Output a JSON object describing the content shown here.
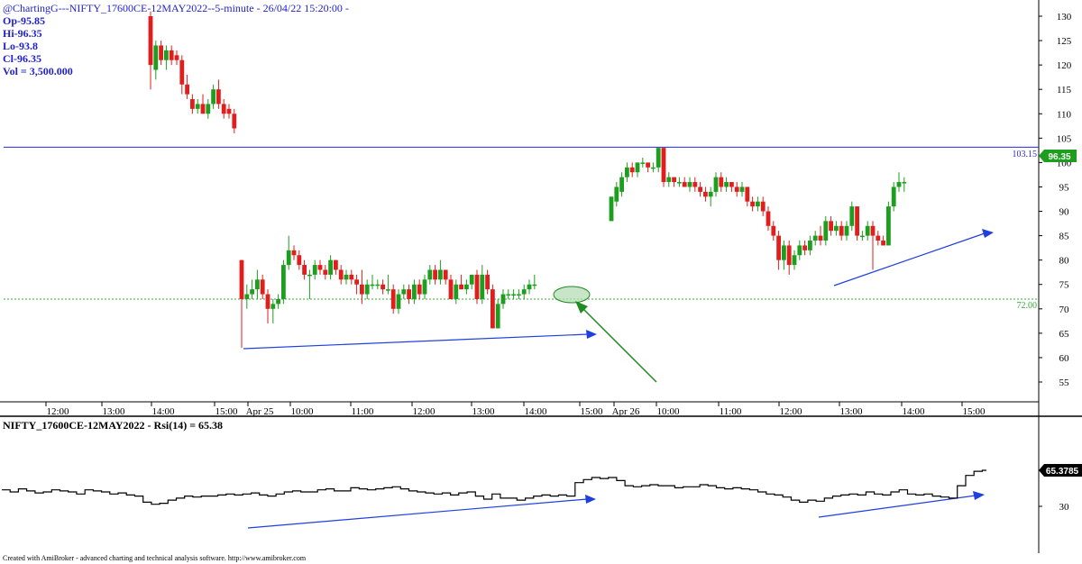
{
  "header": {
    "title": "@ChartingG---NIFTY_17600CE-12MAY2022--5-minute  - 26/04/22 15:20:00 -",
    "open": "Op-95.85",
    "high": "Hi-96.35",
    "low": "Lo-93.8",
    "close": "Cl-96.35",
    "volume": "Vol = 3,500.000"
  },
  "rsi_panel": {
    "title": "NIFTY_17600CE-12MAY2022 - Rsi(14) = 65.38",
    "value_label": "65.3785",
    "axis_label": "30"
  },
  "footer": {
    "credit": "Created with AmiBroker - advanced charting and technical analysis software. http://www.amibroker.com"
  },
  "colors": {
    "up": "#1e9e1e",
    "down": "#e01e1e",
    "trendline": "#1f3fdf",
    "arrow_green": "#1e8c1e",
    "highlight_fill": "#b5dcb5",
    "level_blue": "#2a2ad0",
    "level_green": "#36a836"
  },
  "chart_data": [
    {
      "type": "candlestick",
      "title": "@ChartingG---NIFTY_17600CE-12MAY2022--5-minute  - 26/04/22 15:20:00 -",
      "y_ticks": [
        55,
        60,
        65,
        70,
        75,
        80,
        85,
        90,
        95,
        100,
        105,
        110,
        115,
        120,
        125,
        130
      ],
      "ylim": [
        50,
        135
      ],
      "x_tick_labels": [
        "12:00",
        "13:00",
        "14:00",
        "15:00",
        "Apr 25",
        "10:00",
        "11:00",
        "12:00",
        "13:00",
        "14:00",
        "15:00",
        "Apr 26",
        "10:00",
        "11:00",
        "12:00",
        "13:00",
        "14:00",
        "15:00"
      ],
      "horizontal_levels": [
        {
          "label": "103.15",
          "value": 103.15,
          "color": "#2a2ad0",
          "style": "solid"
        },
        {
          "label": "72.00",
          "value": 72.0,
          "color": "#36a836",
          "style": "dotted"
        }
      ],
      "last_price_label": "96.35",
      "grid": false,
      "candles": [
        {
          "o": 130,
          "h": 131,
          "l": 115,
          "c": 120
        },
        {
          "o": 119,
          "h": 125,
          "l": 117,
          "c": 124
        },
        {
          "o": 124,
          "h": 125,
          "l": 120,
          "c": 121
        },
        {
          "o": 121,
          "h": 124,
          "l": 119,
          "c": 123
        },
        {
          "o": 123,
          "h": 124,
          "l": 120,
          "c": 121
        },
        {
          "o": 122,
          "h": 123,
          "l": 120,
          "c": 121
        },
        {
          "o": 121,
          "h": 122,
          "l": 114,
          "c": 116
        },
        {
          "o": 116,
          "h": 118,
          "l": 113,
          "c": 114
        },
        {
          "o": 113,
          "h": 114,
          "l": 110,
          "c": 111
        },
        {
          "o": 111,
          "h": 113,
          "l": 110,
          "c": 112
        },
        {
          "o": 112,
          "h": 114,
          "l": 110,
          "c": 110
        },
        {
          "o": 110,
          "h": 113,
          "l": 109,
          "c": 112
        },
        {
          "o": 112,
          "h": 116,
          "l": 111,
          "c": 115
        },
        {
          "o": 115,
          "h": 117,
          "l": 111,
          "c": 112
        },
        {
          "o": 112,
          "h": 113,
          "l": 109,
          "c": 110
        },
        {
          "o": 111,
          "h": 112,
          "l": 109,
          "c": 110
        },
        {
          "o": 110,
          "h": 111,
          "l": 106,
          "c": 107
        },
        {
          "o": 80,
          "h": 80,
          "l": 62,
          "c": 72
        },
        {
          "o": 72,
          "h": 75,
          "l": 70,
          "c": 73
        },
        {
          "o": 73,
          "h": 76,
          "l": 72,
          "c": 74
        },
        {
          "o": 74,
          "h": 78,
          "l": 72,
          "c": 76
        },
        {
          "o": 76,
          "h": 77,
          "l": 72,
          "c": 73
        },
        {
          "o": 73,
          "h": 74,
          "l": 67,
          "c": 70
        },
        {
          "o": 70,
          "h": 72,
          "l": 67,
          "c": 71
        },
        {
          "o": 71,
          "h": 73,
          "l": 70,
          "c": 72
        },
        {
          "o": 72,
          "h": 80,
          "l": 71,
          "c": 79
        },
        {
          "o": 79,
          "h": 85,
          "l": 78,
          "c": 82
        },
        {
          "o": 82,
          "h": 83,
          "l": 80,
          "c": 81
        },
        {
          "o": 81,
          "h": 82,
          "l": 78,
          "c": 79
        },
        {
          "o": 79,
          "h": 80,
          "l": 76,
          "c": 77
        },
        {
          "o": 77,
          "h": 78,
          "l": 72,
          "c": 77
        },
        {
          "o": 77,
          "h": 80,
          "l": 76,
          "c": 79
        },
        {
          "o": 79,
          "h": 80,
          "l": 77,
          "c": 78
        },
        {
          "o": 78,
          "h": 79,
          "l": 76,
          "c": 77
        },
        {
          "o": 77,
          "h": 81,
          "l": 76,
          "c": 80
        },
        {
          "o": 80,
          "h": 80,
          "l": 77,
          "c": 78
        },
        {
          "o": 78,
          "h": 79,
          "l": 75,
          "c": 76
        },
        {
          "o": 76,
          "h": 78,
          "l": 75,
          "c": 77
        },
        {
          "o": 77,
          "h": 78,
          "l": 75,
          "c": 76
        },
        {
          "o": 76,
          "h": 77,
          "l": 73,
          "c": 75
        },
        {
          "o": 75,
          "h": 78,
          "l": 71,
          "c": 73
        },
        {
          "o": 73,
          "h": 76,
          "l": 72,
          "c": 75
        },
        {
          "o": 75,
          "h": 77,
          "l": 74,
          "c": 75
        },
        {
          "o": 75,
          "h": 76,
          "l": 74,
          "c": 75
        },
        {
          "o": 75,
          "h": 76,
          "l": 73,
          "c": 74
        },
        {
          "o": 74,
          "h": 77,
          "l": 73,
          "c": 74
        },
        {
          "o": 74,
          "h": 75,
          "l": 69,
          "c": 70
        },
        {
          "o": 70,
          "h": 74,
          "l": 69,
          "c": 73
        },
        {
          "o": 73,
          "h": 75,
          "l": 72,
          "c": 74
        },
        {
          "o": 74,
          "h": 75,
          "l": 71,
          "c": 72
        },
        {
          "o": 72,
          "h": 76,
          "l": 71,
          "c": 75
        },
        {
          "o": 75,
          "h": 76,
          "l": 72,
          "c": 73
        },
        {
          "o": 73,
          "h": 77,
          "l": 72,
          "c": 76
        },
        {
          "o": 76,
          "h": 79,
          "l": 75,
          "c": 78
        },
        {
          "o": 78,
          "h": 79,
          "l": 75,
          "c": 76
        },
        {
          "o": 76,
          "h": 80,
          "l": 75,
          "c": 78
        },
        {
          "o": 78,
          "h": 78,
          "l": 75,
          "c": 76
        },
        {
          "o": 76,
          "h": 77,
          "l": 72,
          "c": 72
        },
        {
          "o": 72,
          "h": 76,
          "l": 71,
          "c": 75
        },
        {
          "o": 75,
          "h": 77,
          "l": 74,
          "c": 74
        },
        {
          "o": 74,
          "h": 76,
          "l": 73,
          "c": 75
        },
        {
          "o": 75,
          "h": 77,
          "l": 74,
          "c": 77
        },
        {
          "o": 77,
          "h": 78,
          "l": 71,
          "c": 72
        },
        {
          "o": 72,
          "h": 79,
          "l": 71,
          "c": 77
        },
        {
          "o": 77,
          "h": 78,
          "l": 73,
          "c": 74
        },
        {
          "o": 74,
          "h": 75,
          "l": 66,
          "c": 66
        },
        {
          "o": 66,
          "h": 72,
          "l": 66,
          "c": 71
        },
        {
          "o": 71,
          "h": 74,
          "l": 70,
          "c": 73
        },
        {
          "o": 73,
          "h": 74,
          "l": 72,
          "c": 73
        },
        {
          "o": 73,
          "h": 74,
          "l": 72,
          "c": 73
        },
        {
          "o": 73,
          "h": 74,
          "l": 72,
          "c": 73
        },
        {
          "o": 73,
          "h": 75,
          "l": 72,
          "c": 74
        },
        {
          "o": 74,
          "h": 76,
          "l": 73,
          "c": 75
        },
        {
          "o": 75,
          "h": 77,
          "l": 74,
          "c": 75
        },
        {
          "o": 88,
          "h": 93,
          "l": 88,
          "c": 93
        },
        {
          "o": 92,
          "h": 96,
          "l": 91,
          "c": 95
        },
        {
          "o": 94,
          "h": 98,
          "l": 93,
          "c": 97
        },
        {
          "o": 97,
          "h": 100,
          "l": 96,
          "c": 99
        },
        {
          "o": 99,
          "h": 100,
          "l": 97,
          "c": 98
        },
        {
          "o": 98,
          "h": 100,
          "l": 97,
          "c": 100
        },
        {
          "o": 100,
          "h": 101,
          "l": 99,
          "c": 100
        },
        {
          "o": 100,
          "h": 100,
          "l": 98,
          "c": 99
        },
        {
          "o": 99,
          "h": 100,
          "l": 98,
          "c": 99
        },
        {
          "o": 99,
          "h": 103,
          "l": 98,
          "c": 103
        },
        {
          "o": 103,
          "h": 103,
          "l": 95,
          "c": 96
        },
        {
          "o": 96,
          "h": 98,
          "l": 95,
          "c": 97
        },
        {
          "o": 97,
          "h": 97,
          "l": 95,
          "c": 96
        },
        {
          "o": 96,
          "h": 97,
          "l": 95,
          "c": 96
        },
        {
          "o": 96,
          "h": 97,
          "l": 95,
          "c": 95
        },
        {
          "o": 95,
          "h": 97,
          "l": 94,
          "c": 96
        },
        {
          "o": 96,
          "h": 97,
          "l": 94,
          "c": 95
        },
        {
          "o": 95,
          "h": 96,
          "l": 93,
          "c": 94
        },
        {
          "o": 94,
          "h": 95,
          "l": 92,
          "c": 93
        },
        {
          "o": 93,
          "h": 95,
          "l": 91,
          "c": 94
        },
        {
          "o": 94,
          "h": 98,
          "l": 93,
          "c": 97
        },
        {
          "o": 97,
          "h": 98,
          "l": 94,
          "c": 95
        },
        {
          "o": 95,
          "h": 97,
          "l": 94,
          "c": 96
        },
        {
          "o": 96,
          "h": 96,
          "l": 94,
          "c": 95
        },
        {
          "o": 95,
          "h": 96,
          "l": 93,
          "c": 94
        },
        {
          "o": 94,
          "h": 96,
          "l": 93,
          "c": 95
        },
        {
          "o": 95,
          "h": 95,
          "l": 91,
          "c": 92
        },
        {
          "o": 92,
          "h": 93,
          "l": 90,
          "c": 91
        },
        {
          "o": 91,
          "h": 93,
          "l": 90,
          "c": 92
        },
        {
          "o": 92,
          "h": 93,
          "l": 89,
          "c": 90
        },
        {
          "o": 90,
          "h": 91,
          "l": 86,
          "c": 87
        },
        {
          "o": 87,
          "h": 88,
          "l": 84,
          "c": 85
        },
        {
          "o": 85,
          "h": 86,
          "l": 78,
          "c": 80
        },
        {
          "o": 80,
          "h": 84,
          "l": 78,
          "c": 83
        },
        {
          "o": 83,
          "h": 84,
          "l": 77,
          "c": 79
        },
        {
          "o": 79,
          "h": 82,
          "l": 78,
          "c": 81
        },
        {
          "o": 81,
          "h": 84,
          "l": 80,
          "c": 83
        },
        {
          "o": 83,
          "h": 84,
          "l": 81,
          "c": 82
        },
        {
          "o": 82,
          "h": 85,
          "l": 81,
          "c": 84
        },
        {
          "o": 84,
          "h": 86,
          "l": 83,
          "c": 85
        },
        {
          "o": 85,
          "h": 87,
          "l": 83,
          "c": 84
        },
        {
          "o": 84,
          "h": 89,
          "l": 83,
          "c": 88
        },
        {
          "o": 88,
          "h": 89,
          "l": 85,
          "c": 86
        },
        {
          "o": 86,
          "h": 88,
          "l": 85,
          "c": 87
        },
        {
          "o": 87,
          "h": 88,
          "l": 84,
          "c": 85
        },
        {
          "o": 85,
          "h": 88,
          "l": 84,
          "c": 87
        },
        {
          "o": 87,
          "h": 92,
          "l": 86,
          "c": 91
        },
        {
          "o": 91,
          "h": 91,
          "l": 84,
          "c": 85
        },
        {
          "o": 85,
          "h": 86,
          "l": 84,
          "c": 85
        },
        {
          "o": 85,
          "h": 88,
          "l": 84,
          "c": 87
        },
        {
          "o": 87,
          "h": 88,
          "l": 78,
          "c": 85
        },
        {
          "o": 85,
          "h": 86,
          "l": 83,
          "c": 84
        },
        {
          "o": 84,
          "h": 85,
          "l": 83,
          "c": 83
        },
        {
          "o": 83,
          "h": 92,
          "l": 83,
          "c": 91
        },
        {
          "o": 91,
          "h": 96,
          "l": 90,
          "c": 95
        },
        {
          "o": 95,
          "h": 98,
          "l": 94,
          "c": 96
        },
        {
          "o": 96,
          "h": 97,
          "l": 94,
          "c": 96
        }
      ]
    },
    {
      "type": "line",
      "title": "NIFTY_17600CE-12MAY2022 - Rsi(14) = 65.38",
      "series": [
        {
          "name": "Rsi(14)",
          "values": [
            46,
            46,
            44,
            44,
            47,
            47,
            45,
            45,
            43,
            43,
            44,
            44,
            46,
            46,
            45,
            45,
            44,
            44,
            42,
            42,
            46,
            46,
            45,
            45,
            44,
            44,
            42,
            42,
            43,
            43,
            41,
            41,
            40,
            40,
            34,
            34,
            32,
            32,
            33,
            33,
            36,
            36,
            38,
            38,
            40,
            40,
            39,
            39,
            40,
            40,
            40,
            40,
            41,
            41,
            42,
            42,
            41,
            41,
            42,
            42,
            43,
            43,
            41,
            41,
            40,
            40,
            42,
            42,
            44,
            44,
            45,
            45,
            44,
            44,
            44,
            44,
            46,
            46,
            47,
            47,
            45,
            45,
            45,
            45,
            48,
            48,
            47,
            47,
            46,
            46,
            47,
            47,
            48,
            48,
            49,
            49,
            47,
            47,
            45,
            45,
            44,
            44,
            43,
            43,
            42,
            42,
            43,
            43,
            41,
            41,
            43,
            43,
            44,
            44,
            40,
            40,
            37,
            37,
            42,
            42,
            38,
            38,
            38,
            38,
            36,
            36,
            38,
            38,
            40,
            40,
            41,
            41,
            40,
            40,
            41,
            41,
            40,
            40,
            53,
            53,
            56,
            56,
            58,
            58,
            57,
            57,
            58,
            58,
            55,
            55,
            50,
            50,
            49,
            49,
            50,
            50,
            51,
            51,
            50,
            50,
            50,
            50,
            48,
            48,
            49,
            49,
            49,
            49,
            51,
            51,
            50,
            50,
            48,
            48,
            47,
            47,
            48,
            48,
            47,
            47,
            46,
            46,
            44,
            44,
            42,
            42,
            41,
            41,
            39,
            39,
            36,
            36,
            34,
            34,
            36,
            36,
            35,
            35,
            38,
            38,
            40,
            40,
            41,
            41,
            42,
            42,
            41,
            41,
            44,
            44,
            42,
            42,
            41,
            41,
            44,
            44,
            46,
            46,
            42,
            42,
            41,
            41,
            42,
            42,
            40,
            40,
            39,
            39,
            38,
            38,
            50,
            50,
            60,
            60,
            64,
            64,
            65,
            65
          ]
        }
      ]
    }
  ]
}
